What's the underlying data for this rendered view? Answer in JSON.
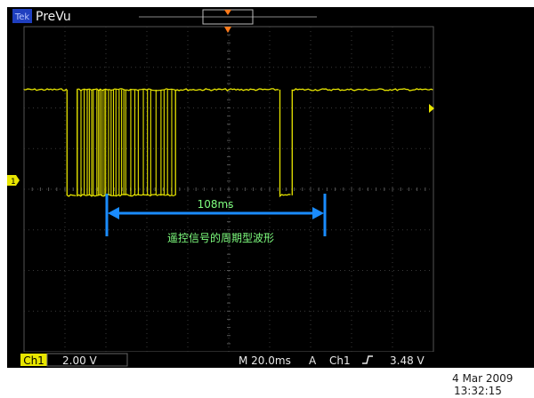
{
  "header": {
    "mode_badge": "Tek",
    "acq_status": "PreVu"
  },
  "annotation": {
    "duration": "108ms",
    "caption": "遥控信号的周期型波形"
  },
  "status_bar": {
    "channel": "Ch1",
    "volts_per_div": "2.00 V",
    "timebase": "M 20.0ms",
    "trigger_label": "A",
    "trigger_source": "Ch1",
    "trigger_slope": "rising-edge-icon",
    "trigger_level": "3.48 V"
  },
  "timestamp": {
    "date": "4 Mar 2009",
    "time": "13:32:15"
  },
  "colors": {
    "screen": "#000000",
    "grid": "#3a3a3a",
    "trace": "#e8e600",
    "annotation": "#1a8cff",
    "annotation_text": "#7fff7f",
    "status_text": "#e8e8e8",
    "trigger_marker": "#ff7a1a"
  },
  "chart_data": {
    "type": "line",
    "grid_divisions": {
      "x": 10,
      "y": 8
    },
    "trace": "Ch1 digital pulse train",
    "high_level_div": 2.45,
    "low_level_div": -0.15,
    "segments_ms": [
      {
        "start": -100,
        "end": -79,
        "level": "high"
      },
      {
        "start": -79,
        "end": -74,
        "level": "low"
      },
      {
        "start": -74,
        "end": -26,
        "level": "burst"
      },
      {
        "start": -26,
        "end": 25,
        "level": "high"
      },
      {
        "start": 25,
        "end": 31,
        "level": "low"
      },
      {
        "start": 31,
        "end": 100,
        "level": "high"
      }
    ],
    "measurement": {
      "label": "108ms",
      "from_ms": -79,
      "to_ms": 29
    }
  }
}
